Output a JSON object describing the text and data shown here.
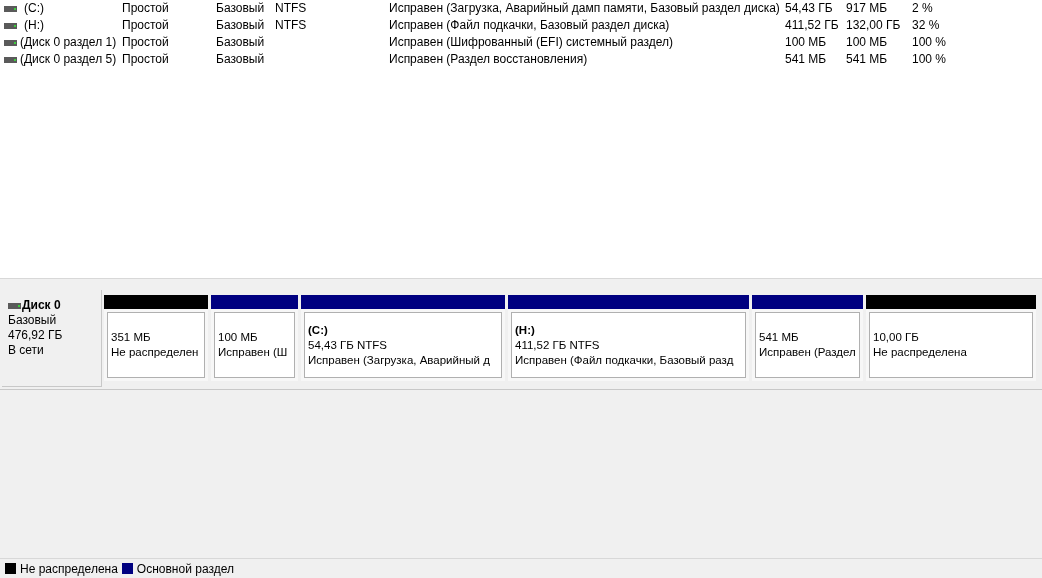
{
  "volumes": [
    {
      "name": "(C:)",
      "layout": "Простой",
      "type": "Базовый",
      "fs": "NTFS",
      "status": "Исправен (Загрузка, Аварийный дамп памяти, Базовый раздел диска)",
      "capacity": "54,43 ГБ",
      "free": "917 МБ",
      "percent": "2 %"
    },
    {
      "name": "(H:)",
      "layout": "Простой",
      "type": "Базовый",
      "fs": "NTFS",
      "status": "Исправен (Файл подкачки, Базовый раздел диска)",
      "capacity": "411,52 ГБ",
      "free": "132,00 ГБ",
      "percent": "32 %"
    },
    {
      "name": "(Диск 0 раздел 1)",
      "layout": "Простой",
      "type": "Базовый",
      "status": "Исправен (Шифрованный (EFI) системный раздел)",
      "capacity": "100 МБ",
      "free": "100 МБ",
      "percent": "100 %"
    },
    {
      "name": "(Диск 0 раздел 5)",
      "layout": "Простой",
      "type": "Базовый",
      "status": "Исправен (Раздел восстановления)",
      "capacity": "541 МБ",
      "free": "541 МБ",
      "percent": "100 %"
    }
  ],
  "disk": {
    "name": "Диск 0",
    "type": "Базовый",
    "size": "476,92 ГБ",
    "state": "В сети",
    "partitions": [
      {
        "size": "351 МБ",
        "status": "Не распределен",
        "color": "#000000"
      },
      {
        "size": "100 МБ",
        "status": "Исправен (Ш",
        "color": "#000080"
      },
      {
        "label": "(C:)",
        "size": "54,43 ГБ NTFS",
        "status": "Исправен (Загрузка, Аварийный д",
        "color": "#000080"
      },
      {
        "label": "(H:)",
        "size": "411,52 ГБ NTFS",
        "status": "Исправен (Файл подкачки, Базовый разд",
        "color": "#000080"
      },
      {
        "size": "541 МБ",
        "status": "Исправен (Раздел",
        "color": "#000080"
      },
      {
        "size": "10,00 ГБ",
        "status": "Не распределена",
        "color": "#000000"
      }
    ]
  },
  "legend": [
    {
      "label": "Не распределена",
      "color": "#000000"
    },
    {
      "label": "Основной раздел",
      "color": "#000080"
    }
  ]
}
